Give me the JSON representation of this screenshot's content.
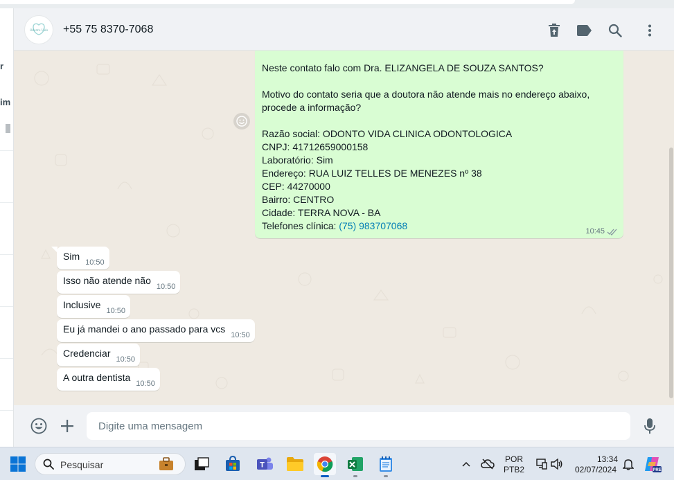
{
  "header": {
    "contact_name": "+55 75 8370-7068",
    "avatar_text": "Odonto Vida",
    "icons": [
      "delete-icon",
      "label-icon",
      "search-icon",
      "menu-icon"
    ]
  },
  "sidebar_fragment": {
    "text_1": "r",
    "text_2": "im"
  },
  "outgoing_message": {
    "lines": [
      "Neste contato falo com Dra. ELIZANGELA DE SOUZA SANTOS?",
      "",
      "Motivo do contato seria que a doutora não atende mais no endereço abaixo,",
      "procede a informação?",
      "",
      "Razão social: ODONTO VIDA CLINICA ODONTOLOGICA",
      "CNPJ: 41712659000158",
      "Laboratório: Sim",
      "Endereço: RUA LUIZ TELLES DE MENEZES nº 38",
      "CEP: 44270000",
      "Bairro: CENTRO",
      "Cidade: TERRA NOVA - BA"
    ],
    "phone_label": "Telefones clínica: ",
    "phone_value": "(75) 983707068",
    "time": "10:45",
    "status_icon": "double-check-icon"
  },
  "incoming_messages": [
    {
      "text": "Sim",
      "time": "10:50"
    },
    {
      "text": "Isso não atende não",
      "time": "10:50"
    },
    {
      "text": "Inclusive",
      "time": "10:50"
    },
    {
      "text": "Eu já mandei o ano passado para vcs",
      "time": "10:50"
    },
    {
      "text": "Credenciar",
      "time": "10:50"
    },
    {
      "text": "A outra dentista",
      "time": "10:50"
    }
  ],
  "composer": {
    "placeholder": "Digite uma mensagem",
    "value": ""
  },
  "taskbar": {
    "search_label": "Pesquisar",
    "lang_top": "POR",
    "lang_bottom": "PTB2",
    "time": "13:34",
    "date": "02/07/2024",
    "copilot_badge": "PRE"
  },
  "colors": {
    "outgoing_bubble": "#d9fdd3",
    "incoming_bubble": "#ffffff",
    "chat_background": "#efeae2",
    "link": "#027eb5"
  }
}
